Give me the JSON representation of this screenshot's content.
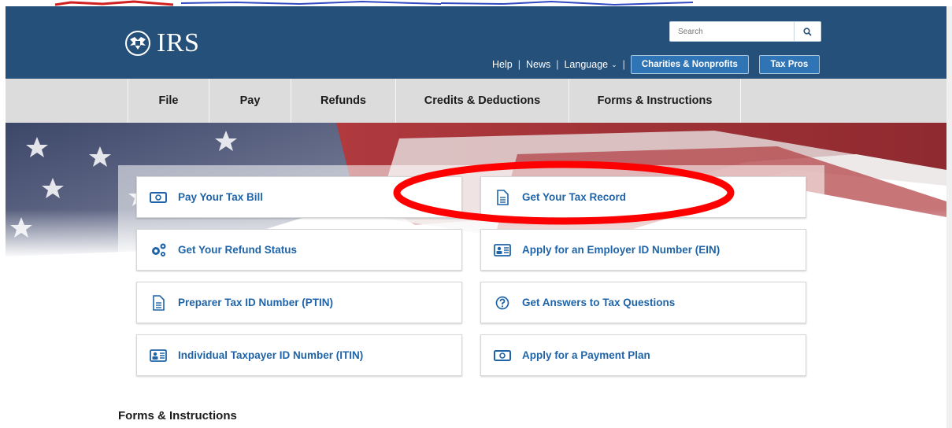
{
  "brand": {
    "logo_text": "IRS",
    "header_color": "#24507a",
    "accent_color": "#2f74b5"
  },
  "search": {
    "placeholder": "Search",
    "button_icon": "search-icon"
  },
  "utility_nav": {
    "help": "Help",
    "news": "News",
    "language": "Language",
    "charities": "Charities & Nonprofits",
    "tax_pros": "Tax Pros"
  },
  "main_nav": [
    {
      "label": "File"
    },
    {
      "label": "Pay"
    },
    {
      "label": "Refunds"
    },
    {
      "label": "Credits & Deductions"
    },
    {
      "label": "Forms & Instructions"
    }
  ],
  "quick_links": [
    {
      "label": "Pay Your Tax Bill",
      "icon": "money-icon"
    },
    {
      "label": "Get Your Tax Record",
      "icon": "document-icon"
    },
    {
      "label": "Get Your Refund Status",
      "icon": "gears-icon"
    },
    {
      "label": "Apply for an Employer ID Number (EIN)",
      "icon": "id-card-icon"
    },
    {
      "label": "Preparer Tax ID Number (PTIN)",
      "icon": "document-icon"
    },
    {
      "label": "Get Answers to Tax Questions",
      "icon": "question-circle-icon"
    },
    {
      "label": "Individual Taxpayer ID Number (ITIN)",
      "icon": "id-card-icon"
    },
    {
      "label": "Apply for a Payment Plan",
      "icon": "money-icon"
    }
  ],
  "section": {
    "title": "Forms & Instructions"
  },
  "annotation": {
    "color": "#ff0000",
    "highlights": "Get Your Tax Record"
  }
}
